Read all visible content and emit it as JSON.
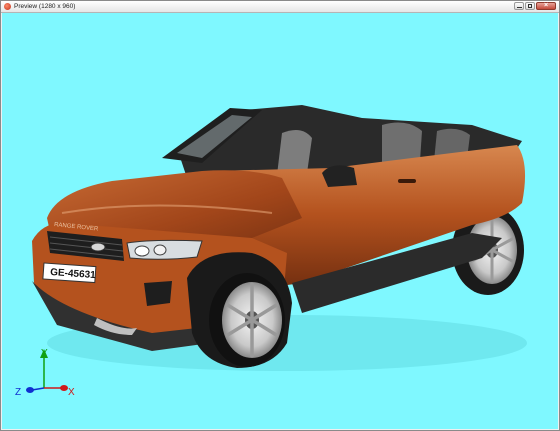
{
  "window": {
    "title": "Preview (1280 x 960)",
    "icon": "app-icon",
    "controls": {
      "minimize_icon": "minimize-icon",
      "maximize_icon": "maximize-icon",
      "close_icon": "close-icon"
    }
  },
  "viewport": {
    "background": "#7ff8ff",
    "car": {
      "body_color": "#b4521e",
      "plate": "GE-45631",
      "grille_text": "RANGE ROVER"
    },
    "axes": {
      "x_label": "X",
      "y_label": "Y",
      "z_label": "Z",
      "x_color": "#d01818",
      "y_color": "#10a010",
      "z_color": "#1030d0"
    }
  }
}
